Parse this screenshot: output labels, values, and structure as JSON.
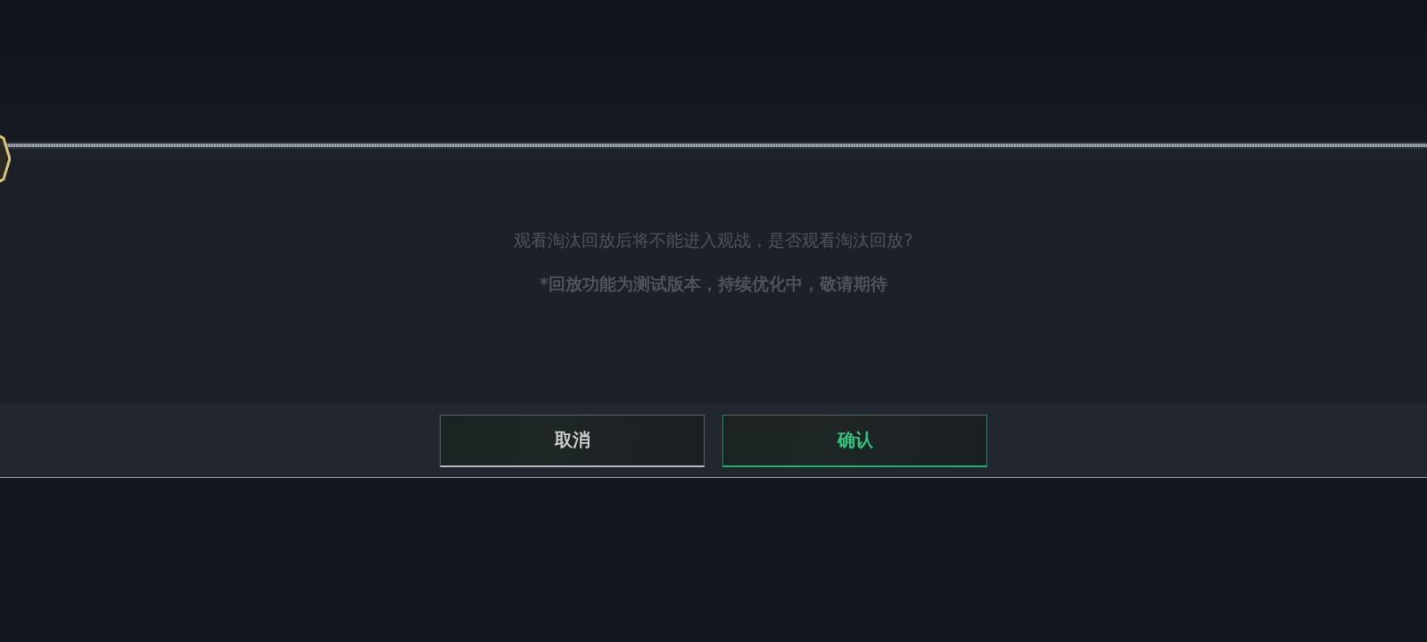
{
  "dialog": {
    "message": "观看淘汰回放后将不能进入观战，是否观看淘汰回放?",
    "note": "*回放功能为测试版本，持续优化中，敬请期待",
    "buttons": [
      {
        "label": "取消",
        "kind": "cancel"
      },
      {
        "label": "确认",
        "kind": "confirm"
      }
    ]
  }
}
